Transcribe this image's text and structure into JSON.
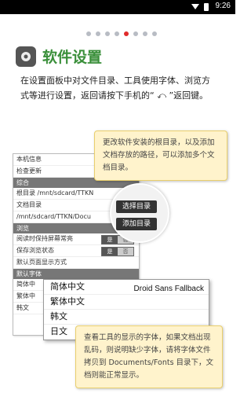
{
  "status_bar": {
    "time": "9:26"
  },
  "pager": {
    "total": 8,
    "active_index": 4
  },
  "header": {
    "title": "软件设置"
  },
  "description": "在设置面板中对文件目录、工具使用字体、浏览方式等进行设置，返回请按下手机的“ ⤺ ”返回键。",
  "settings": {
    "rows": {
      "info": "本机信息",
      "update": "检查更新",
      "section_general": "综合",
      "root_dir": "根目录 /mnt/sdcard/TTKN",
      "doc_dir": "文档目录",
      "doc_path": "/mnt/sdcard/TTKN/Docu",
      "section_browse": "浏览",
      "keep_screen": "阅读时保持屏幕常亮",
      "save_state": "保存浏览状态",
      "default_view": "默认页面显示方式",
      "section_font": "默认字体",
      "font_sc": "简体中",
      "font_tc": "繁体中",
      "font_ko": "韩文"
    },
    "toggle_yes": "是",
    "toggle_no": "否",
    "toggle_other": "选择"
  },
  "buttons": {
    "choose_dir": "选择目录",
    "add_dir": "添加目录"
  },
  "tooltip_dirs": "更改软件安装的根目录，以及添加文档存放的路径，可以添加多个文档目录。",
  "tooltip_fonts": "查看工具的显示的字体，如果文档出现乱码，则说明缺少字体，请将字体文件拷贝到 Documents/Fonts 目录下，文档则能正常显示。",
  "font_options": {
    "fallback": "Droid Sans Fallback",
    "items": [
      "简体中文",
      "繁体中文",
      "韩文",
      "日文"
    ]
  }
}
